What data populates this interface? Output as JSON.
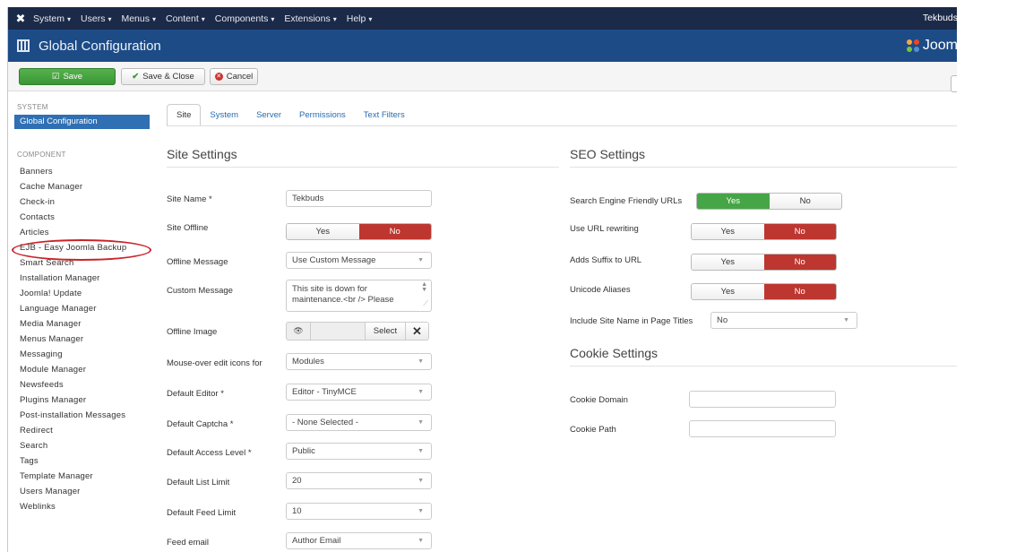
{
  "menubar": {
    "items": [
      "System",
      "Users",
      "Menus",
      "Content",
      "Components",
      "Extensions",
      "Help"
    ],
    "user": "Tekbuds"
  },
  "titlebar": {
    "title": "Global Configuration",
    "brand": "Joom"
  },
  "toolbar": {
    "save": "Save",
    "save_close": "Save & Close",
    "cancel": "Cancel"
  },
  "sidebar": {
    "system_heading": "SYSTEM",
    "active": "Global Configuration",
    "component_heading": "COMPONENT",
    "items": [
      "Banners",
      "Cache Manager",
      "Check-in",
      "Contacts",
      "Articles",
      "EJB - Easy Joomla Backup",
      "Smart Search",
      "Installation Manager",
      "Joomla! Update",
      "Language Manager",
      "Media Manager",
      "Menus Manager",
      "Messaging",
      "Module Manager",
      "Newsfeeds",
      "Plugins Manager",
      "Post-installation Messages",
      "Redirect",
      "Search",
      "Tags",
      "Template Manager",
      "Users Manager",
      "Weblinks"
    ],
    "highlight_color": "#c8242b"
  },
  "tabs": [
    "Site",
    "System",
    "Server",
    "Permissions",
    "Text Filters"
  ],
  "site_settings": {
    "title": "Site Settings",
    "site_name_label": "Site Name *",
    "site_name_value": "Tekbuds",
    "site_offline_label": "Site Offline",
    "site_offline_yes": "Yes",
    "site_offline_no": "No",
    "offline_message_label": "Offline Message",
    "offline_message_value": "Use Custom Message",
    "custom_message_label": "Custom Message",
    "custom_message_line1": "This site is down for",
    "custom_message_line2": "maintenance.<br /> Please",
    "offline_image_label": "Offline Image",
    "offline_image_select": "Select",
    "mouseover_label": "Mouse-over edit icons for",
    "mouseover_value": "Modules",
    "editor_label": "Default Editor *",
    "editor_value": "Editor - TinyMCE",
    "captcha_label": "Default Captcha *",
    "captcha_value": "- None Selected -",
    "access_label": "Default Access Level *",
    "access_value": "Public",
    "list_limit_label": "Default List Limit",
    "list_limit_value": "20",
    "feed_limit_label": "Default Feed Limit",
    "feed_limit_value": "10",
    "feed_email_label": "Feed email",
    "feed_email_value": "Author Email"
  },
  "seo_settings": {
    "title": "SEO Settings",
    "sef_label": "Search Engine Friendly URLs",
    "sef_yes": "Yes",
    "sef_no": "No",
    "rewrite_label": "Use URL rewriting",
    "rewrite_yes": "Yes",
    "rewrite_no": "No",
    "suffix_label": "Adds Suffix to URL",
    "suffix_yes": "Yes",
    "suffix_no": "No",
    "unicode_label": "Unicode Aliases",
    "unicode_yes": "Yes",
    "unicode_no": "No",
    "sitename_label": "Include Site Name in Page Titles",
    "sitename_value": "No"
  },
  "cookie_settings": {
    "title": "Cookie Settings",
    "domain_label": "Cookie Domain",
    "domain_value": "",
    "path_label": "Cookie Path",
    "path_value": ""
  }
}
